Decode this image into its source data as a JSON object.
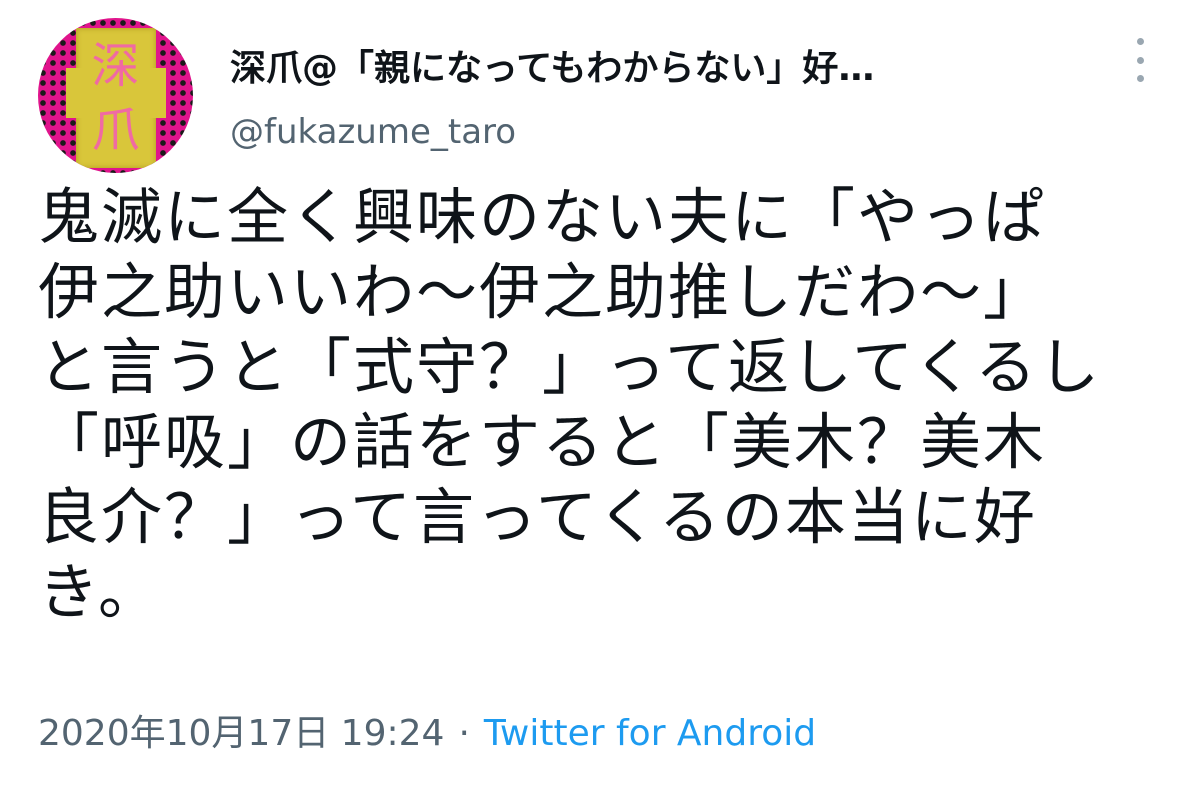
{
  "user": {
    "display_name": "深爪@「親になってもわからない」好…",
    "handle": "@fukazume_taro",
    "avatar_chars": [
      "深",
      "爪"
    ]
  },
  "tweet": {
    "lines": [
      "鬼滅に全く興味のない夫に「やっぱ",
      "伊之助いいわ〜伊之助推しだわ〜」",
      "と言うと「式守？」って返してくるし",
      "「呼吸」の話をすると「美木？美木",
      "良介？」って言ってくるの本当に好",
      "き。"
    ],
    "timestamp": "2020年10月17日 19:24",
    "separator": "·",
    "source": "Twitter for Android"
  },
  "icons": {
    "more": "more-vertical-icon"
  },
  "colors": {
    "text": "#0f1419",
    "secondary": "#536471",
    "link": "#1d9bf0",
    "avatar_bg": "#e0148c",
    "avatar_plate": "#d9c63a",
    "avatar_char": "#f06aa3"
  }
}
